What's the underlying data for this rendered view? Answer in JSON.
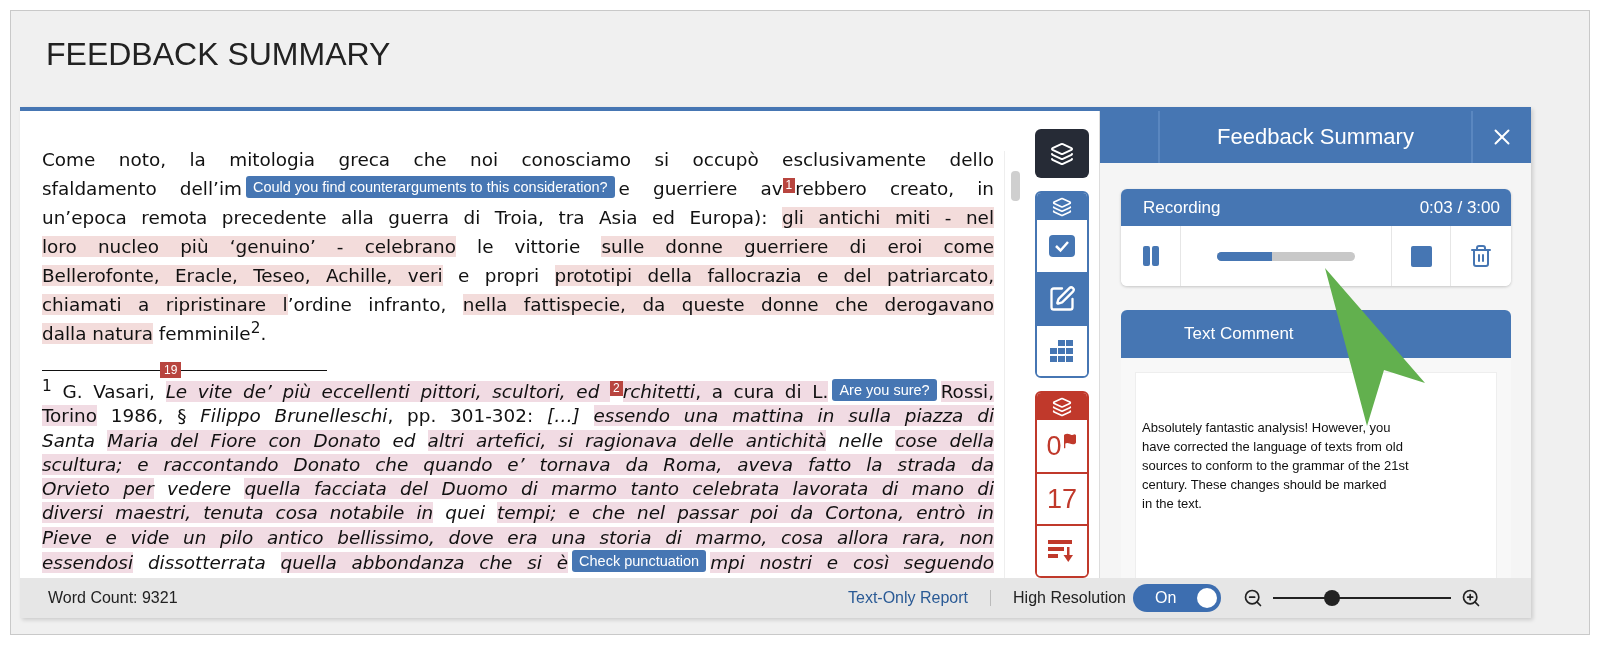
{
  "header": {
    "title": "FEEDBACK SUMMARY"
  },
  "document": {
    "paragraphs": [
      {
        "kind": "body",
        "lines": [
          {
            "justified": true,
            "segments": [
              {
                "kind": "text",
                "text": "Come noto, la mitologia greca che noi conosciamo si occupò esclusivamente dello",
                "highlight": false,
                "italic": false
              }
            ]
          },
          {
            "justified": true,
            "segments": [
              {
                "kind": "text",
                "text": "sfaldamento dell’im",
                "highlight": false,
                "italic": false
              },
              {
                "kind": "tooltip",
                "text": "Could you find counterarguments to this consideration?"
              },
              {
                "kind": "text",
                "text": "e guerriere av",
                "highlight": false,
                "italic": false
              },
              {
                "kind": "marker",
                "text": "1"
              },
              {
                "kind": "text",
                "text": "rebbero creato, in",
                "highlight": false,
                "italic": false
              }
            ]
          },
          {
            "justified": true,
            "segments": [
              {
                "kind": "text",
                "text": "un’epoca remota precedente alla guerra di Troia, tra Asia ed Europa): ",
                "highlight": false,
                "italic": false
              },
              {
                "kind": "text",
                "text": "gli antichi miti - nel",
                "highlight": true,
                "italic": false
              }
            ]
          },
          {
            "justified": true,
            "segments": [
              {
                "kind": "text",
                "text": "loro nucleo più ‘genuino’ - celebrano",
                "highlight": true,
                "italic": false
              },
              {
                "kind": "text",
                "text": " le vittorie ",
                "highlight": false,
                "italic": false
              },
              {
                "kind": "text",
                "text": "sulle donne guerriere di eroi come",
                "highlight": true,
                "italic": false
              }
            ]
          },
          {
            "justified": true,
            "segments": [
              {
                "kind": "text",
                "text": "Bellerofonte, Eracle, Teseo, Achille, veri",
                "highlight": true,
                "italic": false
              },
              {
                "kind": "text",
                "text": " e propri ",
                "highlight": false,
                "italic": false
              },
              {
                "kind": "text",
                "text": "prototipi della fallocrazia e del patriarcato,",
                "highlight": true,
                "italic": false
              }
            ]
          },
          {
            "justified": true,
            "segments": [
              {
                "kind": "text",
                "text": "chiamati a ripristinare l",
                "highlight": true,
                "italic": false
              },
              {
                "kind": "text",
                "text": "’ordine infranto, ",
                "highlight": false,
                "italic": false
              },
              {
                "kind": "text",
                "text": "nella fattispecie, da queste donne che derogavano",
                "highlight": true,
                "italic": false
              }
            ]
          },
          {
            "justified": false,
            "segments": [
              {
                "kind": "text",
                "text": "dalla natura",
                "highlight": true,
                "italic": false
              },
              {
                "kind": "text",
                "text": " femminile$^{2}$.",
                "highlight": false,
                "italic": false
              }
            ]
          }
        ]
      },
      {
        "kind": "footnote",
        "rule_marker": "19",
        "lines": [
          {
            "justified": true,
            "segments": [
              {
                "kind": "text",
                "text": "$^{1}$ G. Vasari, ",
                "highlight": false,
                "italic": false
              },
              {
                "kind": "text",
                "text": "Le vite de’ più eccellenti pittori, scultori, ed ",
                "highlight": true,
                "italic": true
              },
              {
                "kind": "marker",
                "text": "2"
              },
              {
                "kind": "text",
                "text": "rchitetti",
                "highlight": true,
                "italic": true
              },
              {
                "kind": "text",
                "text": ", a cura di L.",
                "highlight": true,
                "italic": false
              },
              {
                "kind": "tooltip",
                "text": "Are you sure?"
              },
              {
                "kind": "text",
                "text": "Rossi,",
                "highlight": true,
                "italic": false
              }
            ]
          },
          {
            "justified": true,
            "segments": [
              {
                "kind": "text",
                "text": "Torino",
                "highlight": true,
                "italic": false
              },
              {
                "kind": "text",
                "text": " 1986, § ",
                "highlight": false,
                "italic": false
              },
              {
                "kind": "text",
                "text": "Filippo Brunelleschi",
                "highlight": false,
                "italic": true
              },
              {
                "kind": "text",
                "text": ", pp. 301-302: ",
                "highlight": false,
                "italic": false
              },
              {
                "kind": "text",
                "text": "[…] ",
                "highlight": false,
                "italic": true
              },
              {
                "kind": "text",
                "text": "essendo una mattina in sulla piazza di",
                "highlight": true,
                "italic": true
              }
            ]
          },
          {
            "justified": true,
            "segments": [
              {
                "kind": "text",
                "text": "Santa ",
                "highlight": false,
                "italic": true
              },
              {
                "kind": "text",
                "text": "Maria del Fiore con Donato",
                "highlight": true,
                "italic": true
              },
              {
                "kind": "text",
                "text": " ed ",
                "highlight": false,
                "italic": true
              },
              {
                "kind": "text",
                "text": "altri artefici, si ragionava delle antichità",
                "highlight": true,
                "italic": true
              },
              {
                "kind": "text",
                "text": " nelle ",
                "highlight": false,
                "italic": true
              },
              {
                "kind": "text",
                "text": "cose della",
                "highlight": true,
                "italic": true
              }
            ]
          },
          {
            "justified": true,
            "segments": [
              {
                "kind": "text",
                "text": "scultura; e raccontando Donato che quando e’ tornava da Roma, aveva fatto la strada da",
                "highlight": true,
                "italic": true
              }
            ]
          },
          {
            "justified": true,
            "segments": [
              {
                "kind": "text",
                "text": "Orvieto per",
                "highlight": true,
                "italic": true
              },
              {
                "kind": "text",
                "text": " vedere ",
                "highlight": false,
                "italic": true
              },
              {
                "kind": "text",
                "text": "quella facciata del Duomo di marmo tanto celebrata lavorata di mano di",
                "highlight": true,
                "italic": true
              }
            ]
          },
          {
            "justified": true,
            "segments": [
              {
                "kind": "text",
                "text": "diversi maestri, tenuta cosa notabile in",
                "highlight": true,
                "italic": true
              },
              {
                "kind": "text",
                "text": " quei ",
                "highlight": false,
                "italic": true
              },
              {
                "kind": "text",
                "text": "tempi; e che nel passar poi da Cortona, entrò in",
                "highlight": true,
                "italic": true
              }
            ]
          },
          {
            "justified": true,
            "segments": [
              {
                "kind": "text",
                "text": "Pieve e vide un pilo antico bellissimo, dove era una storia di marmo, cosa allora rara, non",
                "highlight": true,
                "italic": true
              }
            ]
          },
          {
            "justified": true,
            "segments": [
              {
                "kind": "text",
                "text": "essendosi",
                "highlight": true,
                "italic": true
              },
              {
                "kind": "text",
                "text": " dissotterrata ",
                "highlight": false,
                "italic": true
              },
              {
                "kind": "text",
                "text": "quella abbondanza che si è",
                "highlight": true,
                "italic": true
              },
              {
                "kind": "tooltip",
                "text": "Check punctuation"
              },
              {
                "kind": "text",
                "text": "mpi nostri e così seguendo",
                "highlight": true,
                "italic": true
              }
            ]
          }
        ]
      }
    ]
  },
  "toolbar": {
    "blue_group": [
      {
        "kind": "check",
        "selected": false
      },
      {
        "kind": "edit",
        "selected": true
      },
      {
        "kind": "grid",
        "selected": false
      }
    ],
    "red_group": [
      {
        "kind": "flags",
        "count": "0"
      },
      {
        "kind": "count",
        "count": "17"
      },
      {
        "kind": "sort"
      }
    ]
  },
  "panel": {
    "title": "Feedback Summary",
    "recording": {
      "label": "Recording",
      "time": "0:03 / 3:00",
      "level": 0.4
    },
    "comment": {
      "title": "Text Comment",
      "text": "Absolutely fantastic analysis! However, you have corrected the language of texts from old sources to conform to the grammar of the 21st century. These changes should be marked\nin the text."
    }
  },
  "status_bar": {
    "word_count": "Word Count: 9321",
    "report_link": "Text-Only Report",
    "resolution": {
      "label": "High Resolution",
      "toggle": "On",
      "on": true
    },
    "zoom": {
      "level": 0.33
    }
  }
}
